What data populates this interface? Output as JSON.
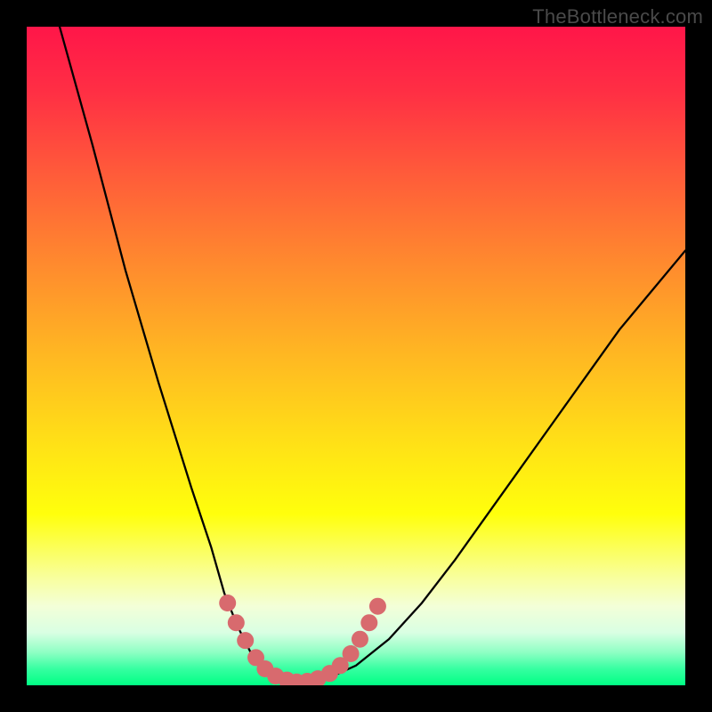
{
  "watermark": "TheBottleneck.com",
  "colors": {
    "page_bg": "#000000",
    "curve": "#000000",
    "marker": "#d86a6e",
    "gradient_top": "#ff1649",
    "gradient_bottom": "#00ff84"
  },
  "chart_data": {
    "type": "line",
    "title": "",
    "xlabel": "",
    "ylabel": "",
    "xlim": [
      0,
      100
    ],
    "ylim": [
      0,
      100
    ],
    "grid": false,
    "legend": false,
    "series": [
      {
        "name": "bottleneck-curve",
        "x": [
          5,
          10,
          15,
          20,
          25,
          28,
          30,
          32,
          34,
          36,
          38,
          40,
          42,
          44,
          46,
          50,
          55,
          60,
          65,
          70,
          75,
          80,
          85,
          90,
          95,
          100
        ],
        "y": [
          100,
          82,
          63,
          46,
          30,
          21,
          14,
          9,
          5,
          2.5,
          1.2,
          0.5,
          0.3,
          0.5,
          1.2,
          3,
          7,
          12.5,
          19,
          26,
          33,
          40,
          47,
          54,
          60,
          66
        ]
      }
    ],
    "markers": {
      "name": "highlight-near-minimum",
      "points": [
        {
          "x": 30.5,
          "y": 12.5
        },
        {
          "x": 31.8,
          "y": 9.5
        },
        {
          "x": 33.2,
          "y": 6.8
        },
        {
          "x": 34.8,
          "y": 4.2
        },
        {
          "x": 36.2,
          "y": 2.5
        },
        {
          "x": 37.8,
          "y": 1.4
        },
        {
          "x": 39.5,
          "y": 0.8
        },
        {
          "x": 41.0,
          "y": 0.5
        },
        {
          "x": 42.6,
          "y": 0.6
        },
        {
          "x": 44.2,
          "y": 1.0
        },
        {
          "x": 46.0,
          "y": 1.8
        },
        {
          "x": 47.6,
          "y": 3.0
        },
        {
          "x": 49.2,
          "y": 4.8
        },
        {
          "x": 50.6,
          "y": 7.0
        },
        {
          "x": 52.0,
          "y": 9.5
        },
        {
          "x": 53.3,
          "y": 12.0
        }
      ]
    }
  }
}
